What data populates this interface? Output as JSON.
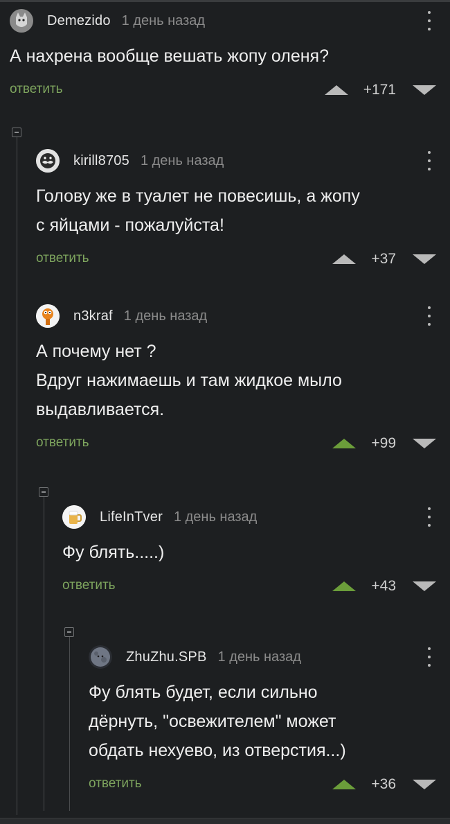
{
  "comments": [
    {
      "nick": "Demezido",
      "time": "1 день назад",
      "avatar_icon": "cat-avatar-icon",
      "lines": [
        "А нахрена вообще вешать жопу оленя?"
      ],
      "reply_label": "ответить",
      "score": "+171",
      "upvoted": false
    },
    {
      "nick": "kirill8705",
      "time": "1 день назад",
      "avatar_icon": "mustache-avatar-icon",
      "lines": [
        "Голову же в туалет не повесишь, а жопу",
        "с яйцами  - пожалуйста!"
      ],
      "reply_label": "ответить",
      "score": "+37",
      "upvoted": false
    },
    {
      "nick": "n3kraf",
      "time": "1 день назад",
      "avatar_icon": "cartoon-avatar-icon",
      "lines": [
        "А почему нет ?",
        "Вдруг нажимаешь и там жидкое мыло",
        "выдавливается."
      ],
      "reply_label": "ответить",
      "score": "+99",
      "upvoted": true
    },
    {
      "nick": "LifeInTver",
      "time": "1 день назад",
      "avatar_icon": "beer-avatar-icon",
      "lines": [
        "Фу блять.....)"
      ],
      "reply_label": "ответить",
      "score": "+43",
      "upvoted": true
    },
    {
      "nick": "ZhuZhu.SPB",
      "time": "1 день назад",
      "avatar_icon": "moon-avatar-icon",
      "lines": [
        "Фу блять будет, если сильно",
        "дёрнуть, \"освежителем\" может",
        "обдать нехуево, из отверстия...)"
      ],
      "reply_label": "ответить",
      "score": "+36",
      "upvoted": true
    }
  ],
  "colors": {
    "background": "#1d1f21",
    "reply_link": "#7ea55e",
    "upvote_active": "#6b9d3a",
    "upvote_inactive": "#b9b9b9"
  }
}
